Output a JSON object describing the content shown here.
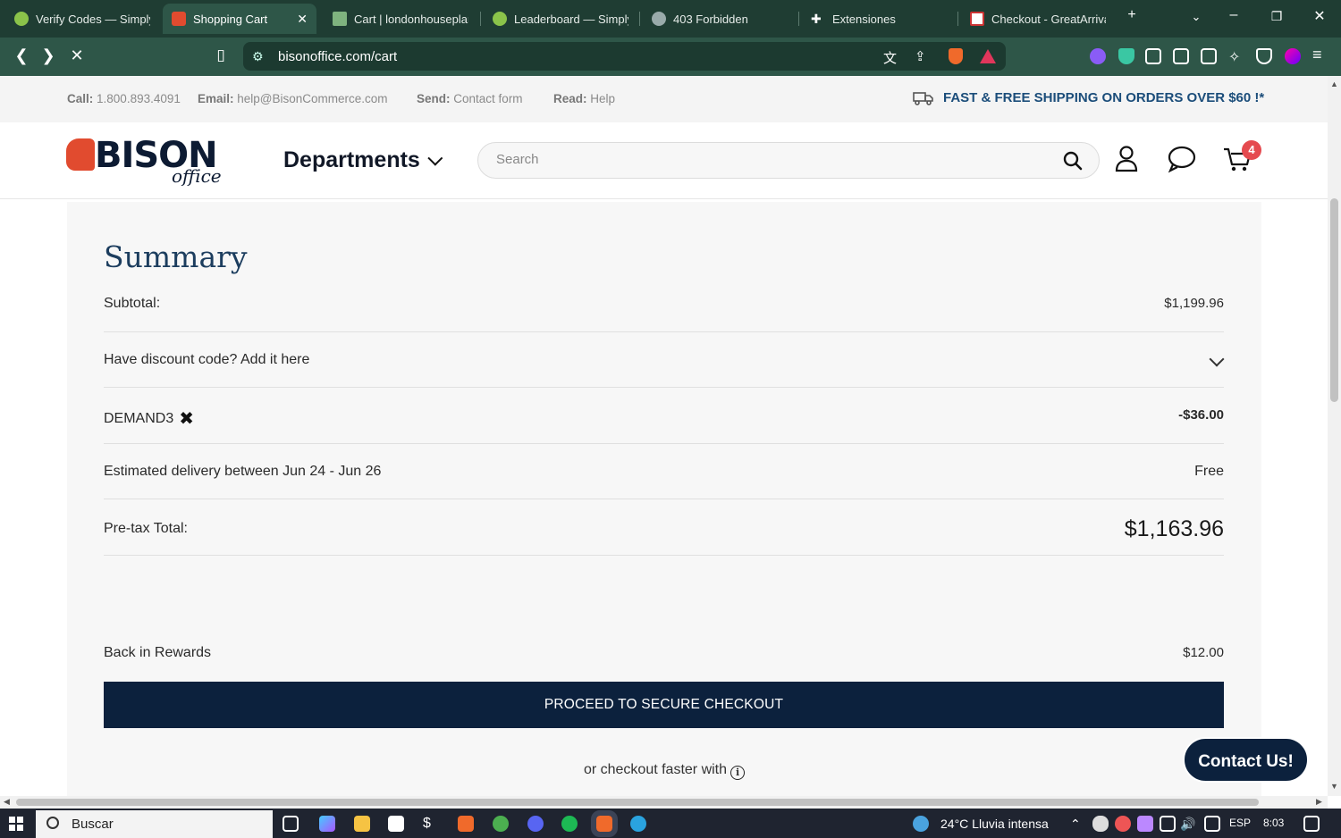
{
  "browser": {
    "tabs": [
      {
        "title": "Verify Codes — Simply",
        "active": false
      },
      {
        "title": "Shopping Cart",
        "active": true
      },
      {
        "title": "Cart | londonhouseplan",
        "active": false
      },
      {
        "title": "Leaderboard — Simply",
        "active": false
      },
      {
        "title": "403 Forbidden",
        "active": false
      },
      {
        "title": "Extensiones",
        "active": false
      },
      {
        "title": "Checkout - GreatArriva",
        "active": false
      }
    ],
    "url": "bisonoffice.com/cart"
  },
  "topbar": {
    "call_label": "Call:",
    "call_value": "1.800.893.4091",
    "email_label": "Email:",
    "email_value": "help@BisonCommerce.com",
    "send_label": "Send:",
    "send_value": "Contact form",
    "read_label": "Read:",
    "read_value": "Help",
    "shipping_banner": "FAST & FREE SHIPPING ON ORDERS OVER $60 !*"
  },
  "header": {
    "logo_word": "BISON",
    "logo_sub": "office",
    "departments_label": "Departments",
    "search_placeholder": "Search",
    "cart_count": "4"
  },
  "summary": {
    "title": "Summary",
    "subtotal_label": "Subtotal:",
    "subtotal_value": "$1,199.96",
    "discount_prompt": "Have discount code? Add it here",
    "coupon_code": "DEMAND3",
    "coupon_value": "-$36.00",
    "delivery_label": "Estimated delivery between Jun 24 - Jun 26",
    "delivery_value": "Free",
    "pretax_label": "Pre-tax Total:",
    "pretax_value": "$1,163.96",
    "rewards_label": "Back in Rewards",
    "rewards_value": "$12.00",
    "checkout_button": "PROCEED TO SECURE CHECKOUT",
    "faster_text": "or checkout faster with"
  },
  "contact_button": "Contact Us!",
  "taskbar": {
    "search_text": "Buscar",
    "weather": "24°C  Lluvia intensa",
    "language": "ESP",
    "time": "8:03"
  }
}
